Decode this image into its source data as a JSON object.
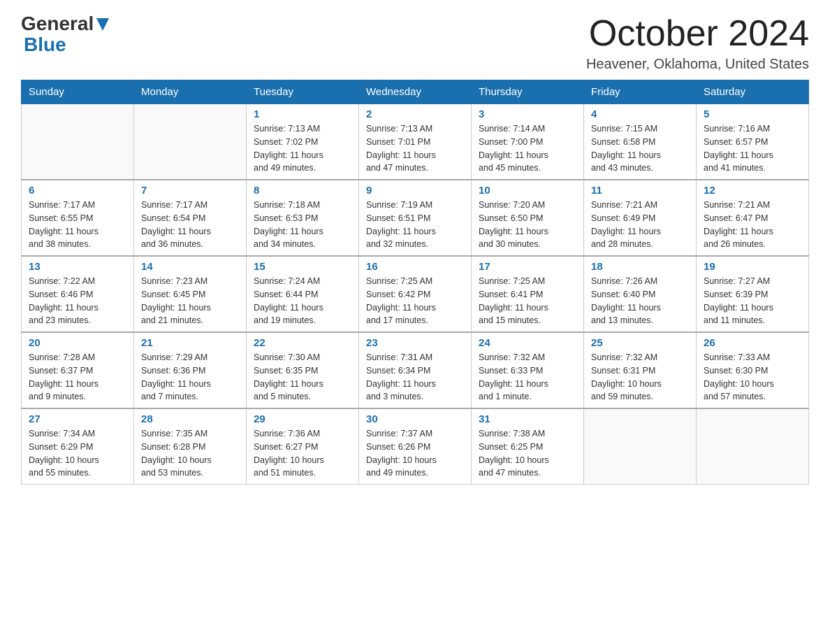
{
  "header": {
    "logo_general": "General",
    "logo_blue": "Blue",
    "month_title": "October 2024",
    "location": "Heavener, Oklahoma, United States"
  },
  "days_of_week": [
    "Sunday",
    "Monday",
    "Tuesday",
    "Wednesday",
    "Thursday",
    "Friday",
    "Saturday"
  ],
  "weeks": [
    [
      {
        "day": "",
        "info": ""
      },
      {
        "day": "",
        "info": ""
      },
      {
        "day": "1",
        "info": "Sunrise: 7:13 AM\nSunset: 7:02 PM\nDaylight: 11 hours\nand 49 minutes."
      },
      {
        "day": "2",
        "info": "Sunrise: 7:13 AM\nSunset: 7:01 PM\nDaylight: 11 hours\nand 47 minutes."
      },
      {
        "day": "3",
        "info": "Sunrise: 7:14 AM\nSunset: 7:00 PM\nDaylight: 11 hours\nand 45 minutes."
      },
      {
        "day": "4",
        "info": "Sunrise: 7:15 AM\nSunset: 6:58 PM\nDaylight: 11 hours\nand 43 minutes."
      },
      {
        "day": "5",
        "info": "Sunrise: 7:16 AM\nSunset: 6:57 PM\nDaylight: 11 hours\nand 41 minutes."
      }
    ],
    [
      {
        "day": "6",
        "info": "Sunrise: 7:17 AM\nSunset: 6:55 PM\nDaylight: 11 hours\nand 38 minutes."
      },
      {
        "day": "7",
        "info": "Sunrise: 7:17 AM\nSunset: 6:54 PM\nDaylight: 11 hours\nand 36 minutes."
      },
      {
        "day": "8",
        "info": "Sunrise: 7:18 AM\nSunset: 6:53 PM\nDaylight: 11 hours\nand 34 minutes."
      },
      {
        "day": "9",
        "info": "Sunrise: 7:19 AM\nSunset: 6:51 PM\nDaylight: 11 hours\nand 32 minutes."
      },
      {
        "day": "10",
        "info": "Sunrise: 7:20 AM\nSunset: 6:50 PM\nDaylight: 11 hours\nand 30 minutes."
      },
      {
        "day": "11",
        "info": "Sunrise: 7:21 AM\nSunset: 6:49 PM\nDaylight: 11 hours\nand 28 minutes."
      },
      {
        "day": "12",
        "info": "Sunrise: 7:21 AM\nSunset: 6:47 PM\nDaylight: 11 hours\nand 26 minutes."
      }
    ],
    [
      {
        "day": "13",
        "info": "Sunrise: 7:22 AM\nSunset: 6:46 PM\nDaylight: 11 hours\nand 23 minutes."
      },
      {
        "day": "14",
        "info": "Sunrise: 7:23 AM\nSunset: 6:45 PM\nDaylight: 11 hours\nand 21 minutes."
      },
      {
        "day": "15",
        "info": "Sunrise: 7:24 AM\nSunset: 6:44 PM\nDaylight: 11 hours\nand 19 minutes."
      },
      {
        "day": "16",
        "info": "Sunrise: 7:25 AM\nSunset: 6:42 PM\nDaylight: 11 hours\nand 17 minutes."
      },
      {
        "day": "17",
        "info": "Sunrise: 7:25 AM\nSunset: 6:41 PM\nDaylight: 11 hours\nand 15 minutes."
      },
      {
        "day": "18",
        "info": "Sunrise: 7:26 AM\nSunset: 6:40 PM\nDaylight: 11 hours\nand 13 minutes."
      },
      {
        "day": "19",
        "info": "Sunrise: 7:27 AM\nSunset: 6:39 PM\nDaylight: 11 hours\nand 11 minutes."
      }
    ],
    [
      {
        "day": "20",
        "info": "Sunrise: 7:28 AM\nSunset: 6:37 PM\nDaylight: 11 hours\nand 9 minutes."
      },
      {
        "day": "21",
        "info": "Sunrise: 7:29 AM\nSunset: 6:36 PM\nDaylight: 11 hours\nand 7 minutes."
      },
      {
        "day": "22",
        "info": "Sunrise: 7:30 AM\nSunset: 6:35 PM\nDaylight: 11 hours\nand 5 minutes."
      },
      {
        "day": "23",
        "info": "Sunrise: 7:31 AM\nSunset: 6:34 PM\nDaylight: 11 hours\nand 3 minutes."
      },
      {
        "day": "24",
        "info": "Sunrise: 7:32 AM\nSunset: 6:33 PM\nDaylight: 11 hours\nand 1 minute."
      },
      {
        "day": "25",
        "info": "Sunrise: 7:32 AM\nSunset: 6:31 PM\nDaylight: 10 hours\nand 59 minutes."
      },
      {
        "day": "26",
        "info": "Sunrise: 7:33 AM\nSunset: 6:30 PM\nDaylight: 10 hours\nand 57 minutes."
      }
    ],
    [
      {
        "day": "27",
        "info": "Sunrise: 7:34 AM\nSunset: 6:29 PM\nDaylight: 10 hours\nand 55 minutes."
      },
      {
        "day": "28",
        "info": "Sunrise: 7:35 AM\nSunset: 6:28 PM\nDaylight: 10 hours\nand 53 minutes."
      },
      {
        "day": "29",
        "info": "Sunrise: 7:36 AM\nSunset: 6:27 PM\nDaylight: 10 hours\nand 51 minutes."
      },
      {
        "day": "30",
        "info": "Sunrise: 7:37 AM\nSunset: 6:26 PM\nDaylight: 10 hours\nand 49 minutes."
      },
      {
        "day": "31",
        "info": "Sunrise: 7:38 AM\nSunset: 6:25 PM\nDaylight: 10 hours\nand 47 minutes."
      },
      {
        "day": "",
        "info": ""
      },
      {
        "day": "",
        "info": ""
      }
    ]
  ]
}
